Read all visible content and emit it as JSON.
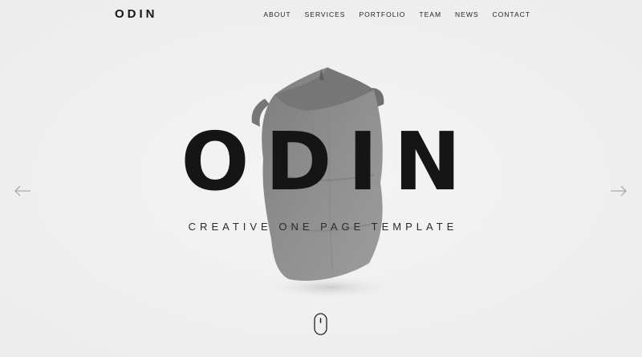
{
  "brand": {
    "logo_text": "ODIN"
  },
  "nav": {
    "items": [
      {
        "label": "ABOUT"
      },
      {
        "label": "SERVICES"
      },
      {
        "label": "PORTFOLIO"
      },
      {
        "label": "TEAM"
      },
      {
        "label": "NEWS"
      },
      {
        "label": "CONTACT"
      }
    ]
  },
  "hero": {
    "title": "ODIN",
    "subtitle": "CREATIVE ONE PAGE TEMPLATE",
    "icons": {
      "prev": "arrow-left-icon",
      "next": "arrow-right-icon",
      "scroll": "mouse-scroll-icon"
    }
  },
  "colors": {
    "background": "#f1f1f1",
    "text": "#151515",
    "bag": "#8a8a8a",
    "arrow": "#9a9a9a"
  }
}
